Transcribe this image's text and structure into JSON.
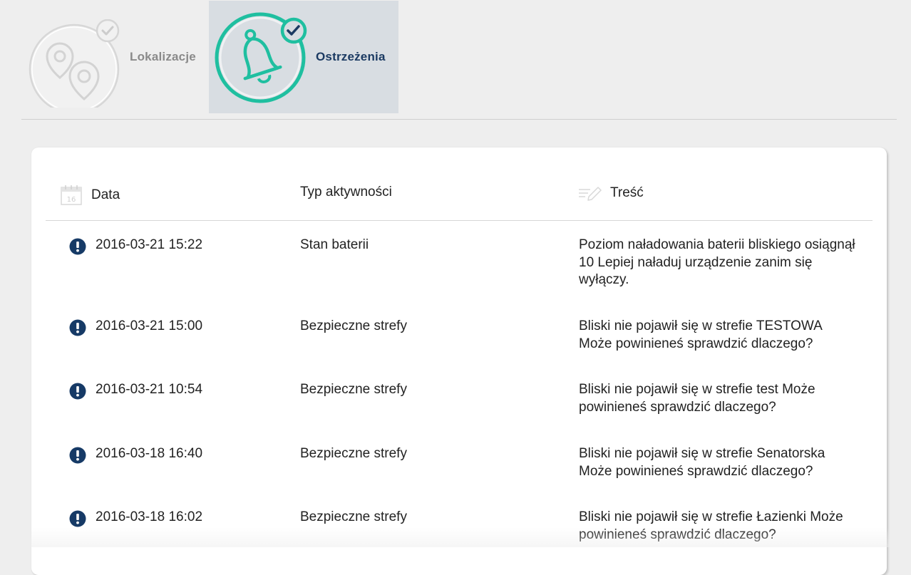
{
  "tabs": [
    {
      "label": "Lokalizacje",
      "icon": "location-pins-icon",
      "active": false
    },
    {
      "label": "Ostrzeżenia",
      "icon": "bell-icon",
      "active": true
    }
  ],
  "colors": {
    "accent": "#1fbfa0",
    "active_tab_bg": "#d8dde2",
    "active_label": "#1b3a62",
    "alert_icon": "#163a66"
  },
  "table": {
    "headers": {
      "date": "Data",
      "type": "Typ aktywności",
      "content": "Treść"
    },
    "header_icons": {
      "date": "calendar-icon",
      "content": "pencil-note-icon"
    },
    "calendar_day": "16",
    "rows": [
      {
        "date": "2016-03-21 15:22",
        "type": "Stan baterii",
        "content": "Poziom naładowania baterii bliskiego osiągnął 10 Lepiej naładuj urządzenie zanim się wyłączy."
      },
      {
        "date": "2016-03-21 15:00",
        "type": "Bezpieczne strefy",
        "content": "Bliski nie pojawił się w strefie TESTOWA Może powinieneś sprawdzić dlaczego?"
      },
      {
        "date": "2016-03-21 10:54",
        "type": "Bezpieczne strefy",
        "content": "Bliski nie pojawił się w strefie test Może powinieneś sprawdzić dlaczego?"
      },
      {
        "date": "2016-03-18 16:40",
        "type": "Bezpieczne strefy",
        "content": "Bliski nie pojawił się w strefie Senatorska Może powinieneś sprawdzić dlaczego?"
      },
      {
        "date": "2016-03-18 16:02",
        "type": "Bezpieczne strefy",
        "content": "Bliski nie pojawił się w strefie Łazienki Może powinieneś sprawdzić dlaczego?"
      }
    ]
  }
}
